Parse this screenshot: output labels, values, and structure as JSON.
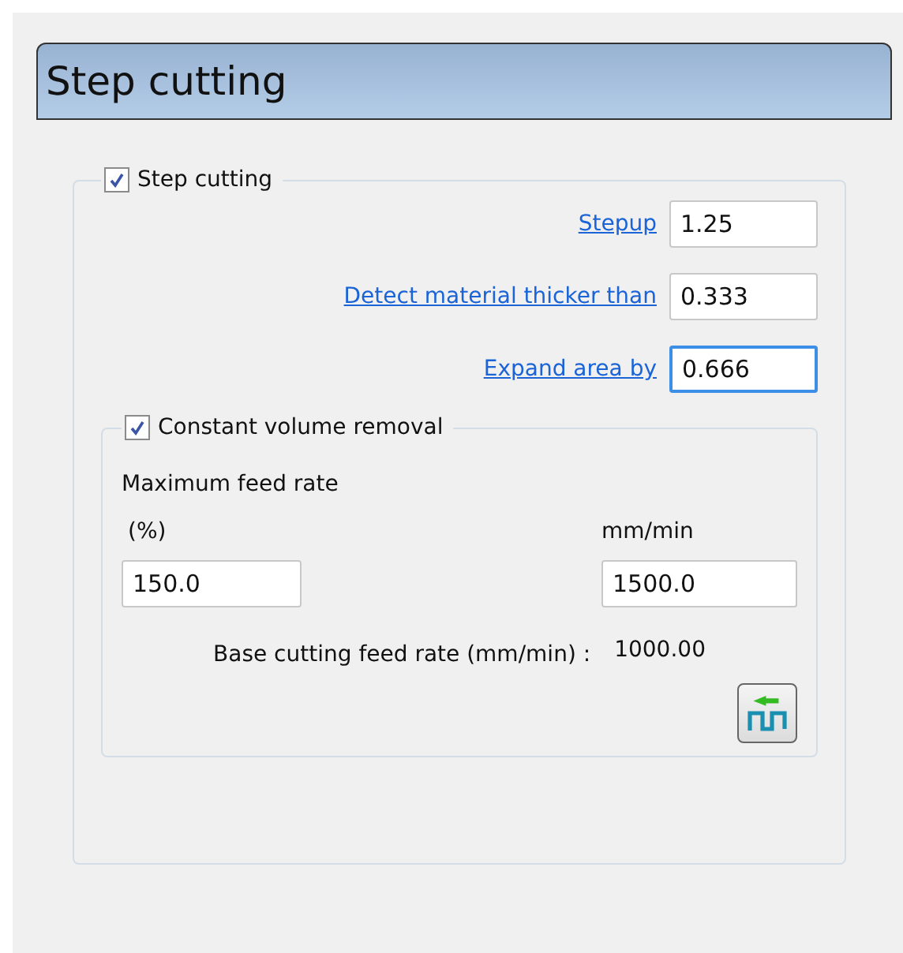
{
  "panel": {
    "title": "Step cutting"
  },
  "step_cutting": {
    "label": "Step cutting",
    "checked": true,
    "fields": [
      {
        "label": "Stepup",
        "value": "1.25",
        "focused": false
      },
      {
        "label": "Detect material thicker than",
        "value": "0.333",
        "focused": false
      },
      {
        "label": "Expand area by",
        "value": "0.666",
        "focused": true
      }
    ]
  },
  "constant_volume": {
    "label": "Constant volume removal",
    "checked": true,
    "heading": "Maximum feed rate",
    "percent": {
      "label": "(%)",
      "value": "150.0"
    },
    "rate": {
      "label": "mm/min",
      "value": "1500.0"
    },
    "base_label": "Base cutting feed rate (mm/min) :",
    "base_value": "1000.00"
  }
}
